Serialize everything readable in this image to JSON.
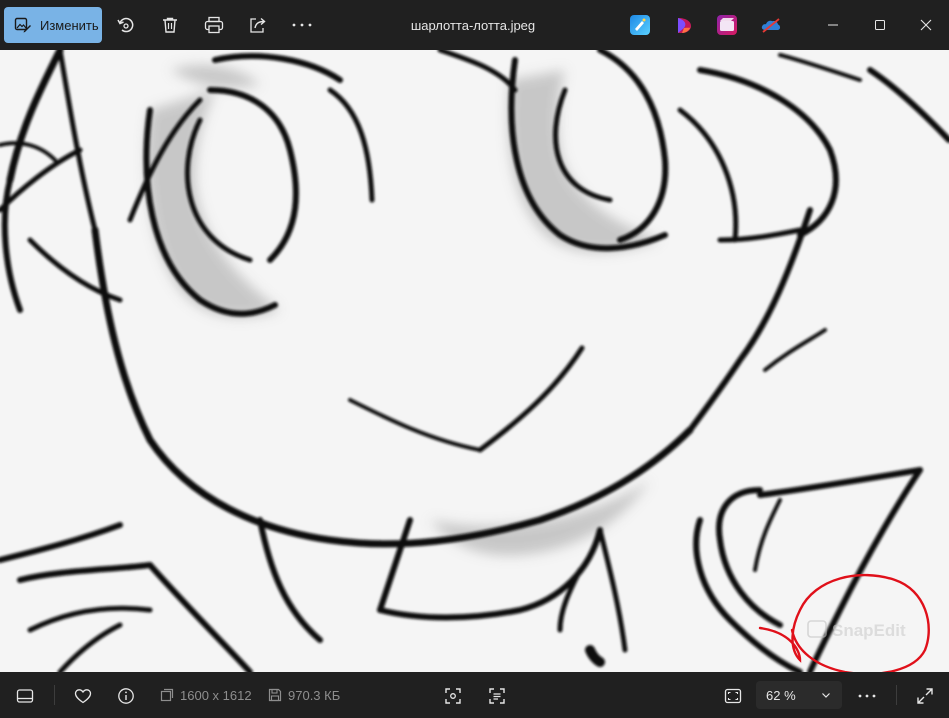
{
  "toolbar": {
    "edit_label": "Изменить",
    "file_name": "шарлотта-лотта.jpeg",
    "icons": [
      "edit-image-icon",
      "rotate-icon",
      "delete-icon",
      "print-icon",
      "share-icon",
      "more-icon"
    ],
    "app_icons": [
      "clipchamp-icon",
      "designer-icon",
      "video-editor-icon",
      "onedrive-icon"
    ],
    "window_controls": [
      "minimize-icon",
      "maximize-icon",
      "close-icon"
    ]
  },
  "canvas": {
    "watermark": "SnapEdit"
  },
  "statusbar": {
    "resolution": "1600 x 1612",
    "file_size": "970.3 КБ",
    "zoom": "62 %",
    "icons": [
      "filmstrip-icon",
      "favorite-heart-icon",
      "info-icon",
      "resolution-icon",
      "save-size-icon",
      "scan-icon",
      "text-recognition-icon",
      "fit-to-window-icon",
      "more-icon",
      "fullscreen-icon"
    ]
  },
  "colors": {
    "accent": "#79b3e6",
    "toolbar_bg": "#202020",
    "annotation_red": "#e0101a"
  }
}
